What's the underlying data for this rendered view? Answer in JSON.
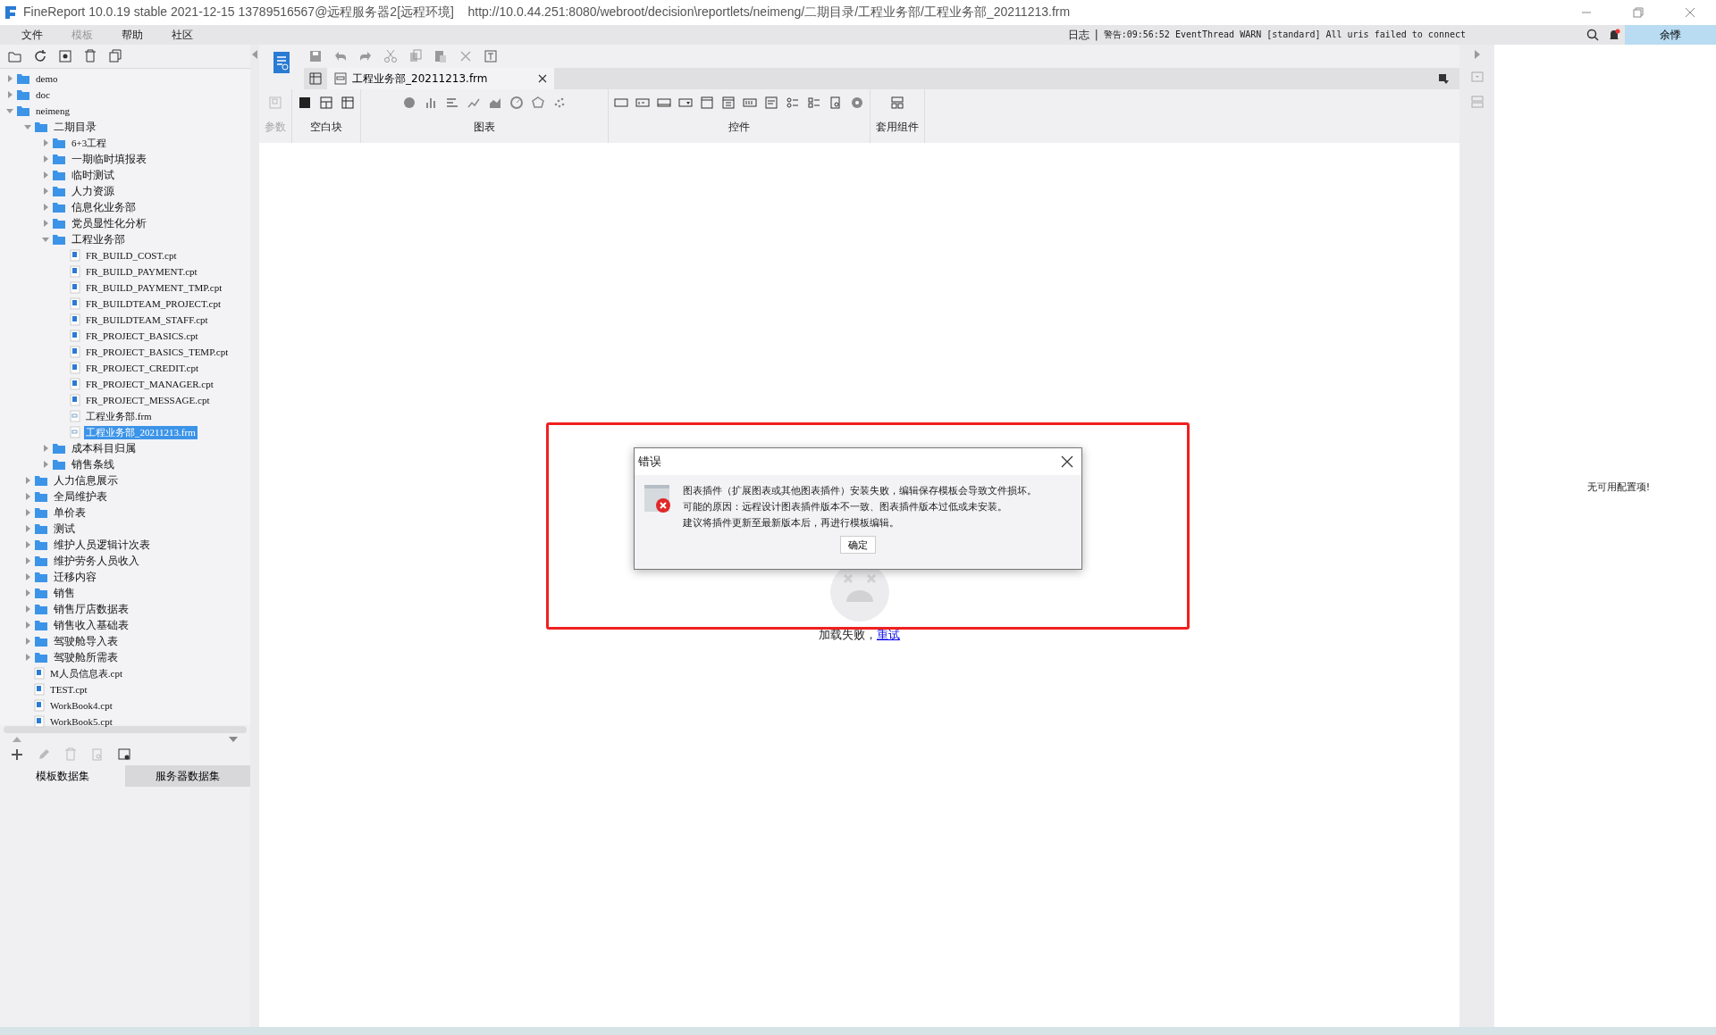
{
  "window": {
    "title": "FineReport 10.0.19 stable 2021-12-15 13789516567@远程服务器2[远程环境]    http://10.0.44.251:8080/webroot/decision\\reportlets/neimeng/二期目录/工程业务部/工程业务部_20211213.frm"
  },
  "menu": [
    {
      "label": "文件",
      "disabled": false
    },
    {
      "label": "模板",
      "disabled": true
    },
    {
      "label": "帮助",
      "disabled": false
    },
    {
      "label": "社区",
      "disabled": false
    }
  ],
  "log": {
    "label": "日志",
    "separator": "|",
    "message": "警告:09:56:52 EventThread WARN [standard] All uris failed to connect"
  },
  "user": "余悸",
  "tree": [
    {
      "kind": "folder",
      "label": "demo",
      "expanded": false,
      "selected": false
    },
    {
      "kind": "folder",
      "label": "doc",
      "expanded": false,
      "selected": false
    },
    {
      "kind": "folder",
      "label": "neimeng",
      "expanded": true,
      "selected": false,
      "children": [
        {
          "kind": "folder",
          "label": "二期目录",
          "expanded": true,
          "selected": false,
          "children": [
            {
              "kind": "folder",
              "label": "6+3工程",
              "expanded": false,
              "selected": false
            },
            {
              "kind": "folder",
              "label": "一期临时填报表",
              "expanded": false,
              "selected": false
            },
            {
              "kind": "folder",
              "label": "临时测试",
              "expanded": false,
              "selected": false
            },
            {
              "kind": "folder",
              "label": "人力资源",
              "expanded": false,
              "selected": false
            },
            {
              "kind": "folder",
              "label": "信息化业务部",
              "expanded": false,
              "selected": false
            },
            {
              "kind": "folder",
              "label": "党员显性化分析",
              "expanded": false,
              "selected": false
            },
            {
              "kind": "folder",
              "label": "工程业务部",
              "expanded": true,
              "selected": false,
              "children": [
                {
                  "kind": "report",
                  "label": "FR_BUILD_COST.cpt",
                  "selected": false
                },
                {
                  "kind": "report",
                  "label": "FR_BUILD_PAYMENT.cpt",
                  "selected": false
                },
                {
                  "kind": "report",
                  "label": "FR_BUILD_PAYMENT_TMP.cpt",
                  "selected": false
                },
                {
                  "kind": "report",
                  "label": "FR_BUILDTEAM_PROJECT.cpt",
                  "selected": false
                },
                {
                  "kind": "report",
                  "label": "FR_BUILDTEAM_STAFF.cpt",
                  "selected": false
                },
                {
                  "kind": "report",
                  "label": "FR_PROJECT_BASICS.cpt",
                  "selected": false
                },
                {
                  "kind": "report",
                  "label": "FR_PROJECT_BASICS_TEMP.cpt",
                  "selected": false
                },
                {
                  "kind": "report",
                  "label": "FR_PROJECT_CREDIT.cpt",
                  "selected": false
                },
                {
                  "kind": "report",
                  "label": "FR_PROJECT_MANAGER.cpt",
                  "selected": false
                },
                {
                  "kind": "report",
                  "label": "FR_PROJECT_MESSAGE.cpt",
                  "selected": false
                },
                {
                  "kind": "form",
                  "label": "工程业务部.frm",
                  "selected": false
                },
                {
                  "kind": "form",
                  "label": "工程业务部_20211213.frm",
                  "selected": true
                }
              ]
            },
            {
              "kind": "folder",
              "label": "成本科目归属",
              "expanded": false,
              "selected": false
            },
            {
              "kind": "folder",
              "label": "销售条线",
              "expanded": false,
              "selected": false
            }
          ]
        },
        {
          "kind": "folder",
          "label": "人力信息展示",
          "expanded": false,
          "selected": false
        },
        {
          "kind": "folder",
          "label": "全局维护表",
          "expanded": false,
          "selected": false
        },
        {
          "kind": "folder",
          "label": "单价表",
          "expanded": false,
          "selected": false
        },
        {
          "kind": "folder",
          "label": "测试",
          "expanded": false,
          "selected": false
        },
        {
          "kind": "folder",
          "label": "维护人员逻辑计次表",
          "expanded": false,
          "selected": false
        },
        {
          "kind": "folder",
          "label": "维护劳务人员收入",
          "expanded": false,
          "selected": false
        },
        {
          "kind": "folder",
          "label": "迁移内容",
          "expanded": false,
          "selected": false
        },
        {
          "kind": "folder",
          "label": "销售",
          "expanded": false,
          "selected": false
        },
        {
          "kind": "folder",
          "label": "销售厅店数据表",
          "expanded": false,
          "selected": false
        },
        {
          "kind": "folder",
          "label": "销售收入基础表",
          "expanded": false,
          "selected": false
        },
        {
          "kind": "folder",
          "label": "驾驶舱导入表",
          "expanded": false,
          "selected": false
        },
        {
          "kind": "folder",
          "label": "驾驶舱所需表",
          "expanded": false,
          "selected": false
        },
        {
          "kind": "report",
          "label": "M人员信息表.cpt",
          "selected": false
        },
        {
          "kind": "report",
          "label": "TEST.cpt",
          "selected": false
        },
        {
          "kind": "report",
          "label": "WorkBook4.cpt",
          "selected": false
        },
        {
          "kind": "report",
          "label": "WorkBook5.cpt",
          "selected": false
        }
      ]
    }
  ],
  "dataset_tabs": [
    {
      "label": "模板数据集",
      "selected": true
    },
    {
      "label": "服务器数据集",
      "selected": false
    }
  ],
  "doc_tab": {
    "label": "工程业务部_20211213.frm"
  },
  "widget_groups": [
    {
      "label": "参数",
      "disabled": true
    },
    {
      "label": "空白块",
      "disabled": false
    },
    {
      "label": "图表",
      "disabled": false
    },
    {
      "label": "控件",
      "disabled": false
    },
    {
      "label": "套用组件",
      "disabled": false
    }
  ],
  "dialog": {
    "title": "错误",
    "lines": [
      "图表插件（扩展图表或其他图表插件）安装失败，编辑保存模板会导致文件损坏。",
      "可能的原因：远程设计图表插件版本不一致、图表插件版本过低或未安装。",
      "建议将插件更新至最新版本后，再进行模板编辑。"
    ],
    "button": "确定"
  },
  "load_error": {
    "message": "加载失败，",
    "link": "重试"
  },
  "right_panel": {
    "message": "无可用配置项!"
  }
}
